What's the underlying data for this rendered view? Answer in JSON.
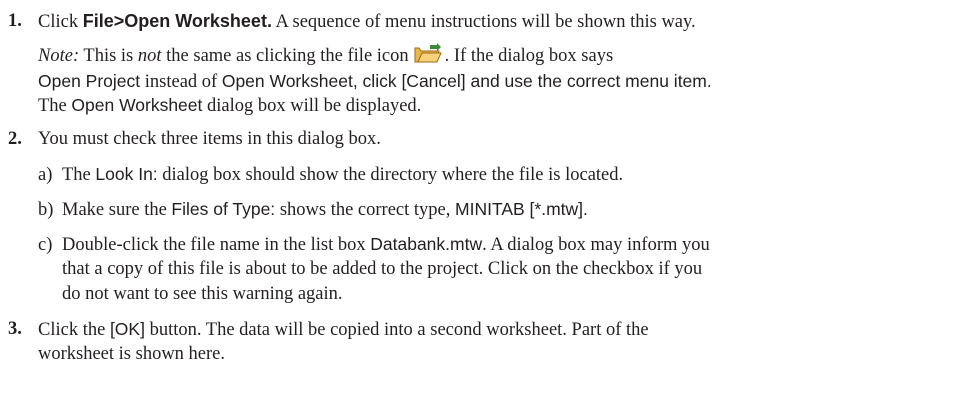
{
  "step1": {
    "number": "1.",
    "prefix": "Click ",
    "menu_path": "File>Open Worksheet.",
    "suffix": " A sequence of menu instructions will be shown this way.",
    "note_label": "Note:",
    "note_a": " This is ",
    "note_not": "not",
    "note_b": " the same as clicking the file icon",
    "note_c": ". If the dialog box says",
    "open_project": "Open Project",
    "instead_of": " instead of ",
    "open_worksheet": "Open Worksheet",
    "note_d": ", click [Cancel] and use the correct menu item.",
    "the": "The ",
    "open_worksheet_2": "Open Worksheet",
    "displayed": " dialog box will be displayed.",
    "icon": "open-folder-icon"
  },
  "step2": {
    "number": "2.",
    "text": "You must check three items in this dialog box.",
    "a_label": "a)",
    "a_pre": "The ",
    "a_look_in": "Look In:",
    "a_post": " dialog box should show the directory where the file is located.",
    "b_label": "b)",
    "b_pre": "Make sure the ",
    "b_files_type": "Files of Type:",
    "b_mid": " shows the correct type, ",
    "b_minitab": "MINITAB [*.mtw].",
    "c_label": "c)",
    "c_pre": "Double-click the file name in the list box ",
    "c_databank": "Databank.mtw",
    "c_post": ". A dialog box may inform you",
    "c_line2": "that a copy of this file is about to be added to the project. Click on the checkbox if you",
    "c_line3": "do not want to see this warning again."
  },
  "step3": {
    "number": "3.",
    "pre": "Click the ",
    "ok": "[OK]",
    "post": " button. The data will be copied into a second worksheet. Part of the",
    "line2": "worksheet is shown here."
  }
}
